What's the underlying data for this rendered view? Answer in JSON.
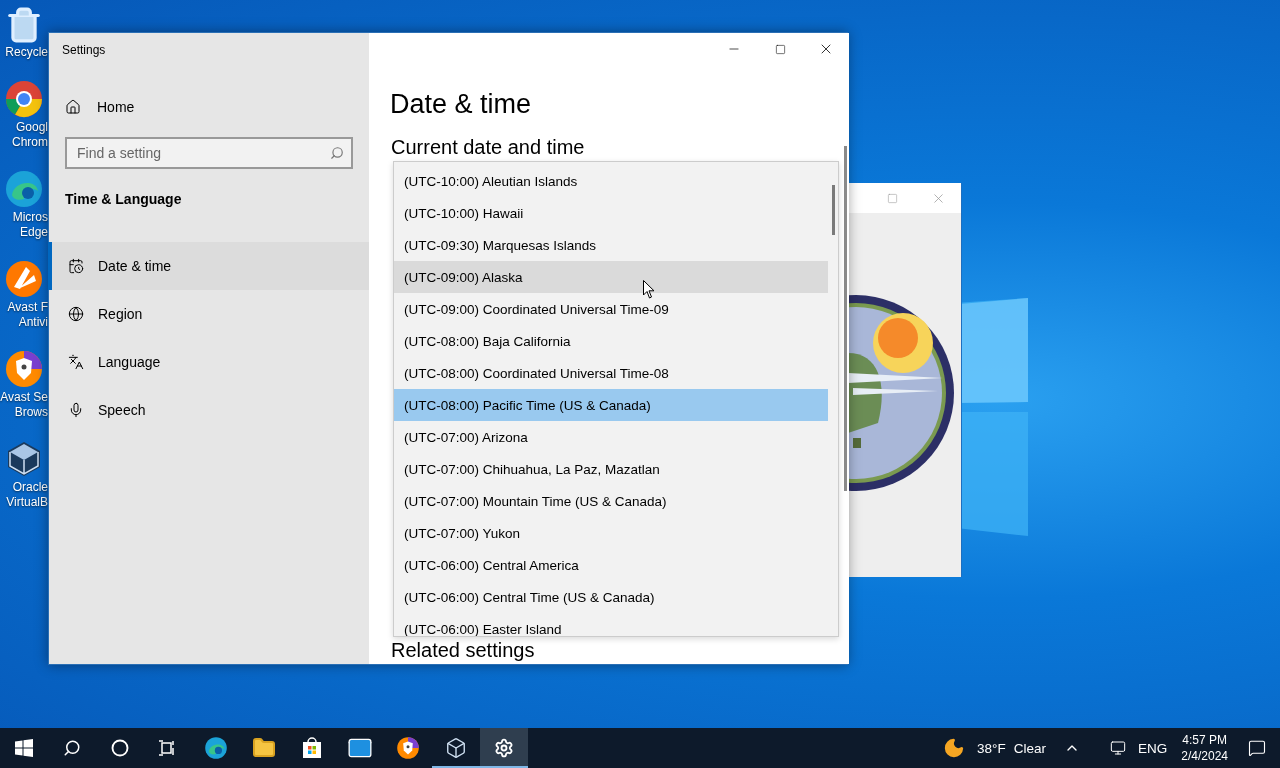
{
  "desktop_icons": [
    {
      "kind": "recycle",
      "lines": [
        "Recycle"
      ]
    },
    {
      "kind": "chrome",
      "lines": [
        "Googl",
        "Chrom"
      ]
    },
    {
      "kind": "edge",
      "lines": [
        "Micros",
        "Edge"
      ]
    },
    {
      "kind": "avast",
      "lines": [
        "Avast F",
        "Antivi"
      ]
    },
    {
      "kind": "avast-browser",
      "lines": [
        "Avast Se",
        "Brows"
      ]
    },
    {
      "kind": "virtualbox",
      "lines": [
        "Oracle",
        "VirtualB"
      ]
    }
  ],
  "settings_window": {
    "title": "Settings",
    "home": "Home",
    "search": {
      "placeholder": "Find a setting"
    },
    "section": "Time & Language",
    "nav": [
      {
        "kind": "calendar",
        "label": "Date & time",
        "selected": true
      },
      {
        "kind": "globe",
        "label": "Region",
        "selected": false
      },
      {
        "kind": "language",
        "label": "Language",
        "selected": false
      },
      {
        "kind": "mic",
        "label": "Speech",
        "selected": false
      }
    ],
    "page_title": "Date & time",
    "subheading": "Current date and time",
    "related": "Related settings",
    "timezones": [
      {
        "label": "(UTC-10:00) Aleutian Islands",
        "selected": false,
        "hovered": false
      },
      {
        "label": "(UTC-10:00) Hawaii",
        "selected": false,
        "hovered": false
      },
      {
        "label": "(UTC-09:30) Marquesas Islands",
        "selected": false,
        "hovered": false
      },
      {
        "label": "(UTC-09:00) Alaska",
        "selected": false,
        "hovered": true
      },
      {
        "label": "(UTC-09:00) Coordinated Universal Time-09",
        "selected": false,
        "hovered": false
      },
      {
        "label": "(UTC-08:00) Baja California",
        "selected": false,
        "hovered": false
      },
      {
        "label": "(UTC-08:00) Coordinated Universal Time-08",
        "selected": false,
        "hovered": false
      },
      {
        "label": "(UTC-08:00) Pacific Time (US & Canada)",
        "selected": true,
        "hovered": false
      },
      {
        "label": "(UTC-07:00) Arizona",
        "selected": false,
        "hovered": false
      },
      {
        "label": "(UTC-07:00) Chihuahua, La Paz, Mazatlan",
        "selected": false,
        "hovered": false
      },
      {
        "label": "(UTC-07:00) Mountain Time (US & Canada)",
        "selected": false,
        "hovered": false
      },
      {
        "label": "(UTC-07:00) Yukon",
        "selected": false,
        "hovered": false
      },
      {
        "label": "(UTC-06:00) Central America",
        "selected": false,
        "hovered": false
      },
      {
        "label": "(UTC-06:00) Central Time (US & Canada)",
        "selected": false,
        "hovered": false
      },
      {
        "label": "(UTC-06:00) Easter Island",
        "selected": false,
        "hovered": false
      }
    ]
  },
  "taskbar": {
    "apps": [
      {
        "kind": "start",
        "running": false,
        "active": false
      },
      {
        "kind": "search",
        "running": false,
        "active": false
      },
      {
        "kind": "cortana",
        "running": false,
        "active": false
      },
      {
        "kind": "task-view",
        "running": false,
        "active": false
      },
      {
        "kind": "edge",
        "running": false,
        "active": false
      },
      {
        "kind": "explorer",
        "running": false,
        "active": false
      },
      {
        "kind": "store",
        "running": false,
        "active": false
      },
      {
        "kind": "mail",
        "running": false,
        "active": false
      },
      {
        "kind": "avast-browser",
        "running": false,
        "active": false
      },
      {
        "kind": "virtualbox",
        "running": true,
        "active": false
      },
      {
        "kind": "settings",
        "running": true,
        "active": true
      }
    ],
    "temperature": "38°F",
    "condition": "Clear",
    "language": "ENG",
    "time": "4:57 PM",
    "date": "2/4/2024"
  }
}
